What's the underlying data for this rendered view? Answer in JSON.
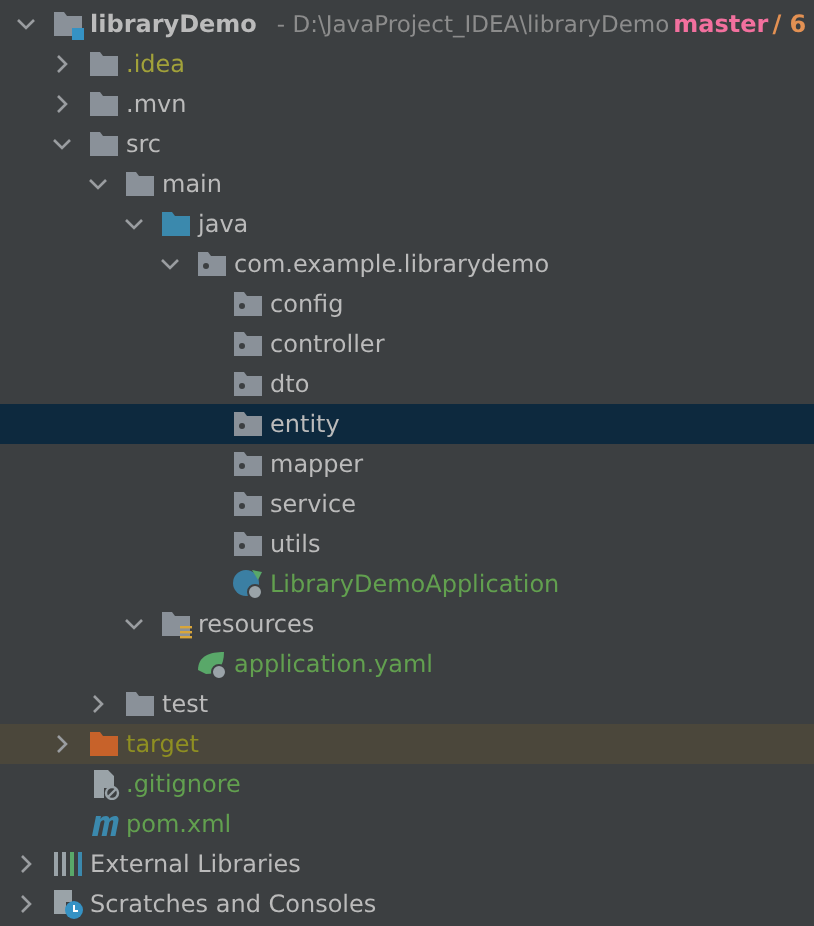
{
  "tree": [
    {
      "label": "libraryDemo",
      "kind": "module",
      "expanded": true,
      "selected": false,
      "color": "#bbbbbb",
      "path": "- D:\\JavaProject_IDEA\\libraryDemo",
      "branch": "master",
      "branch_extra": "/ 6",
      "children": [
        {
          "label": ".idea",
          "kind": "folder",
          "expanded": false,
          "selected": false,
          "color": "#a2a23a"
        },
        {
          "label": ".mvn",
          "kind": "folder",
          "expanded": false,
          "selected": false,
          "color": "#bbbbbb"
        },
        {
          "label": "src",
          "kind": "folder",
          "expanded": true,
          "selected": false,
          "color": "#bbbbbb",
          "children": [
            {
              "label": "main",
              "kind": "folder",
              "expanded": true,
              "selected": false,
              "color": "#bbbbbb",
              "children": [
                {
                  "label": "java",
                  "kind": "source",
                  "expanded": true,
                  "selected": false,
                  "color": "#bbbbbb",
                  "children": [
                    {
                      "label": "com.example.librarydemo",
                      "kind": "package",
                      "expanded": true,
                      "selected": false,
                      "color": "#bbbbbb",
                      "children": [
                        {
                          "label": "config",
                          "kind": "package",
                          "selected": false,
                          "color": "#bbbbbb"
                        },
                        {
                          "label": "controller",
                          "kind": "package",
                          "selected": false,
                          "color": "#bbbbbb"
                        },
                        {
                          "label": "dto",
                          "kind": "package",
                          "selected": false,
                          "color": "#bbbbbb"
                        },
                        {
                          "label": "entity",
                          "kind": "package",
                          "selected": true,
                          "color": "#bbbbbb"
                        },
                        {
                          "label": "mapper",
                          "kind": "package",
                          "selected": false,
                          "color": "#bbbbbb"
                        },
                        {
                          "label": "service",
                          "kind": "package",
                          "selected": false,
                          "color": "#bbbbbb"
                        },
                        {
                          "label": "utils",
                          "kind": "package",
                          "selected": false,
                          "color": "#bbbbbb"
                        },
                        {
                          "label": "LibraryDemoApplication",
                          "kind": "spring-class",
                          "selected": false,
                          "color": "#62a04f"
                        }
                      ]
                    }
                  ]
                },
                {
                  "label": "resources",
                  "kind": "resources",
                  "expanded": true,
                  "selected": false,
                  "color": "#bbbbbb",
                  "children": [
                    {
                      "label": "application.yaml",
                      "kind": "spring-yaml",
                      "selected": false,
                      "color": "#62a04f"
                    }
                  ]
                }
              ]
            },
            {
              "label": "test",
              "kind": "folder",
              "expanded": false,
              "selected": false,
              "color": "#bbbbbb"
            }
          ]
        },
        {
          "label": "target",
          "kind": "excluded",
          "expanded": false,
          "selected": false,
          "color": "#8f8f22"
        },
        {
          "label": ".gitignore",
          "kind": "gitignore",
          "selected": false,
          "color": "#62a04f"
        },
        {
          "label": "pom.xml",
          "kind": "maven",
          "selected": false,
          "color": "#62a04f"
        }
      ]
    },
    {
      "label": "External Libraries",
      "kind": "libraries",
      "expanded": false,
      "selected": false,
      "color": "#bbbbbb"
    },
    {
      "label": "Scratches and Consoles",
      "kind": "scratches",
      "expanded": false,
      "selected": false,
      "color": "#bbbbbb"
    }
  ]
}
